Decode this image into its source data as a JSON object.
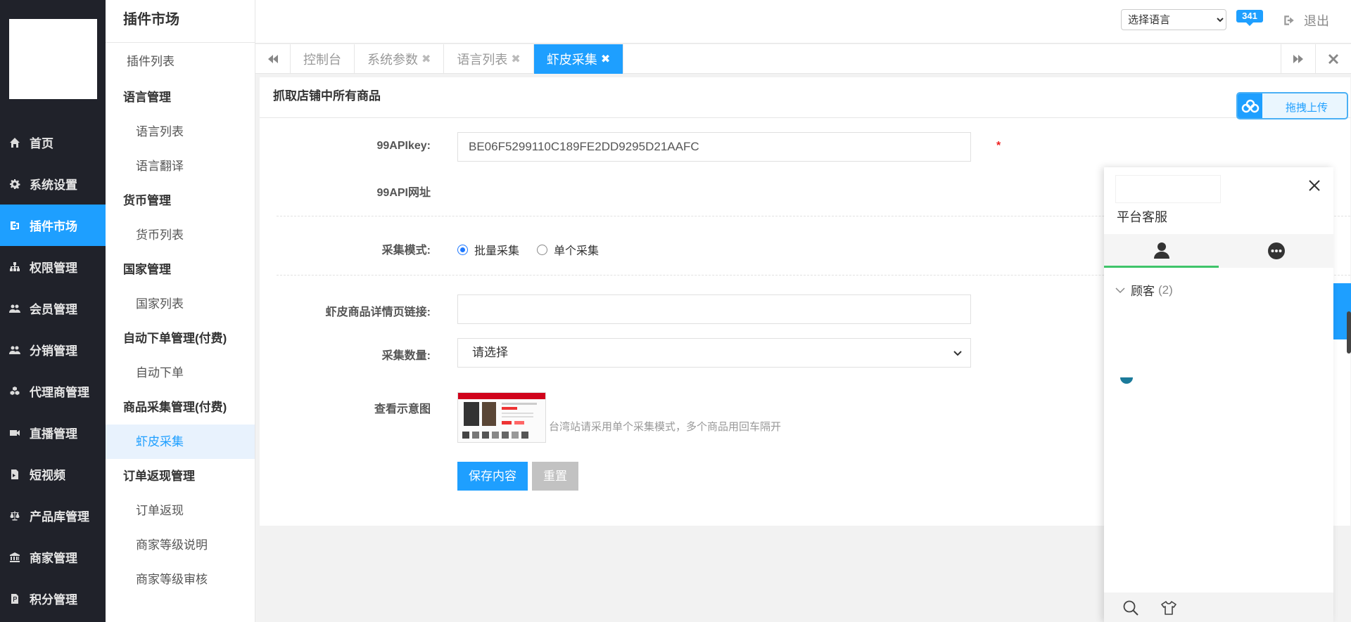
{
  "sidebar": {
    "items": [
      {
        "label": "首页",
        "icon": "home-icon"
      },
      {
        "label": "系统设置",
        "icon": "gear-icon"
      },
      {
        "label": "插件市场",
        "icon": "plugin-icon",
        "active": true
      },
      {
        "label": "权限管理",
        "icon": "sitemap-icon"
      },
      {
        "label": "会员管理",
        "icon": "users-icon"
      },
      {
        "label": "分销管理",
        "icon": "users-icon"
      },
      {
        "label": "代理商管理",
        "icon": "cubes-icon"
      },
      {
        "label": "直播管理",
        "icon": "video-icon"
      },
      {
        "label": "短视频",
        "icon": "short-video-icon"
      },
      {
        "label": "产品库管理",
        "icon": "scale-icon"
      },
      {
        "label": "商家管理",
        "icon": "bank-icon"
      },
      {
        "label": "积分管理",
        "icon": "points-icon"
      }
    ]
  },
  "submenu": {
    "title": "插件市场",
    "first_item": "插件列表",
    "groups": [
      {
        "label": "语言管理",
        "items": [
          "语言列表",
          "语言翻译"
        ]
      },
      {
        "label": "货币管理",
        "items": [
          "货币列表"
        ]
      },
      {
        "label": "国家管理",
        "items": [
          "国家列表"
        ]
      },
      {
        "label": "自动下单管理(付费)",
        "items": [
          "自动下单"
        ]
      },
      {
        "label": "商品采集管理(付费)",
        "items": [
          "虾皮采集"
        ]
      },
      {
        "label": "订单返现管理",
        "items": [
          "订单返现",
          "商家等级说明",
          "商家等级审核"
        ]
      }
    ],
    "active_item": "虾皮采集"
  },
  "header": {
    "language_select": "选择语言",
    "message_count": "341",
    "logout_label": "退出"
  },
  "tabs": [
    {
      "label": "控制台",
      "closable": false
    },
    {
      "label": "系统参数",
      "closable": true
    },
    {
      "label": "语言列表",
      "closable": true
    },
    {
      "label": "虾皮采集",
      "closable": true,
      "active": true
    }
  ],
  "form": {
    "title": "抓取店铺中所有商品",
    "api_key_label": "99APIkey:",
    "api_key_value": "BE06F5299110C189FE2DD9295D21AAFC",
    "required_mark": "*",
    "api_url_label": "99API网址",
    "mode_label": "采集模式:",
    "mode_options": [
      "批量采集",
      "单个采集"
    ],
    "mode_selected": "批量采集",
    "link_label": "虾皮商品详情页链接:",
    "link_value": "",
    "count_label": "采集数量:",
    "count_value": "请选择",
    "preview_label": "查看示意图",
    "hint": "台湾站请采用单个采集模式，多个商品用回车隔开",
    "save_label": "保存内容",
    "reset_label": "重置"
  },
  "upload": {
    "label": "拖拽上传"
  },
  "chat": {
    "title": "平台客服",
    "group_label": "顾客",
    "group_count": "(2)"
  },
  "colors": {
    "sidebar_bg": "#20222a",
    "accent": "#1e9fff",
    "chat_tab_underline": "#3fc46a"
  }
}
